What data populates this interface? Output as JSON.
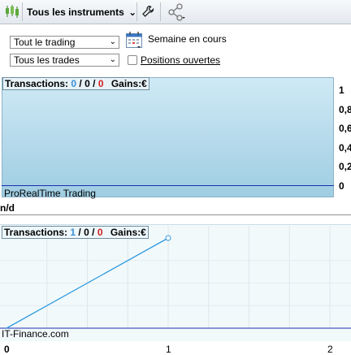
{
  "toolbar": {
    "title": "Tous les instruments",
    "title_caret": "⌄"
  },
  "filters": {
    "trade_type": "Tout le trading",
    "trade_filter": "Tous les trades",
    "period_label": "Semaine en cours",
    "open_positions_label": "Positions ouvertes",
    "open_positions_checked": false,
    "select_arrow": "⌄"
  },
  "chart1": {
    "legend": {
      "label": "Transactions:",
      "v1": "0",
      "sep1": "/",
      "v2": "0",
      "sep2": "/",
      "v3": "0",
      "gains": "Gains:€"
    },
    "source": "ProRealTime Trading",
    "below_label": "n/d",
    "y_ticks": [
      "1",
      "0,8",
      "0,6",
      "0,4",
      "0,2",
      "0"
    ]
  },
  "chart_data": {
    "type": "line",
    "legend": {
      "label": "Transactions:",
      "v1": "1",
      "sep1": "/",
      "v2": "0",
      "sep2": "/",
      "v3": "0",
      "gains": "Gains:€"
    },
    "source": "IT-Finance.com",
    "x_ticks": [
      "0",
      "1",
      "2"
    ],
    "xlim": [
      0,
      2
    ],
    "series": [
      {
        "x": [
          0,
          1
        ],
        "y": [
          0,
          1
        ]
      }
    ],
    "line_color": "#2f9be0",
    "grid": true
  }
}
